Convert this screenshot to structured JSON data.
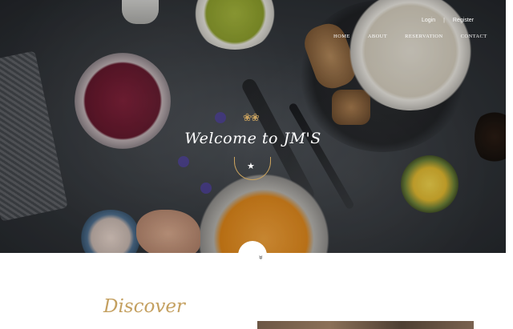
{
  "header": {
    "login_label": "Login",
    "separator": "|",
    "register_label": "Register",
    "nav": [
      {
        "label": "HOME"
      },
      {
        "label": "ABOUT"
      },
      {
        "label": "RESERVATION"
      },
      {
        "label": "CONTACT"
      }
    ]
  },
  "hero": {
    "ornament": "❀❀",
    "title": "Welcome to JM'S",
    "star": "★",
    "scroll_icon": "»"
  },
  "discover": {
    "heading": "Discover"
  },
  "colors": {
    "gold": "#c4a060",
    "nav_text": "#ffffff"
  }
}
